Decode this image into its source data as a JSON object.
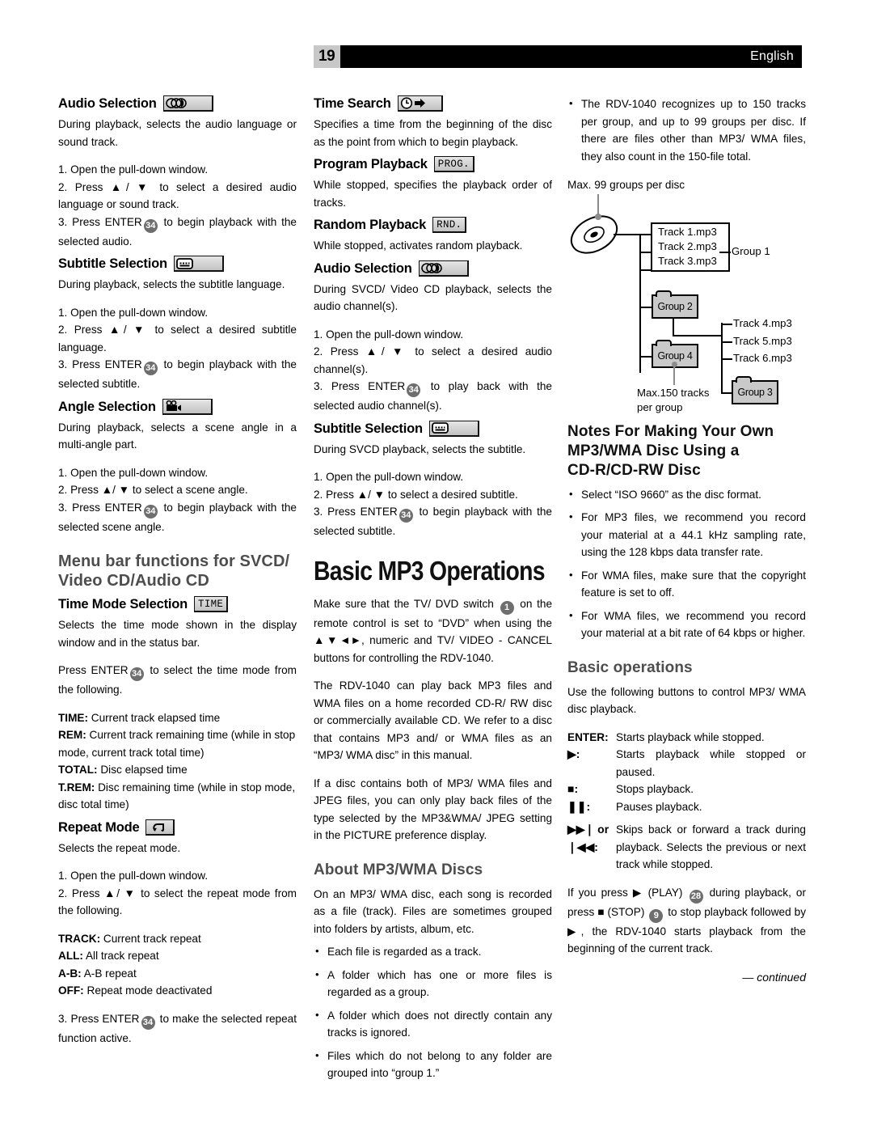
{
  "header": {
    "page_number": "19",
    "language": "English"
  },
  "col1": {
    "audio_selection": {
      "title": "Audio Selection",
      "icon": "audio-channels-icon",
      "desc": "During playback, selects the audio language or sound track.",
      "steps": [
        "1. Open the pull-down window.",
        "2. Press ▲/ ▼ to select a desired audio language or sound track.",
        "3. Press ENTER",
        "to begin playback with the selected audio."
      ],
      "key": "34"
    },
    "subtitle_selection": {
      "title": "Subtitle Selection",
      "icon": "subtitle-icon",
      "desc": "During playback, selects the subtitle language.",
      "steps": [
        "1. Open the pull-down window.",
        "2. Press ▲/ ▼ to select a desired subtitle language.",
        "3. Press ENTER",
        "to begin playback with the selected subtitle."
      ],
      "key": "34"
    },
    "angle_selection": {
      "title": "Angle Selection",
      "icon": "movie-camera-icon",
      "desc": "During playback, selects a scene angle in a multi-angle part.",
      "steps": [
        "1. Open the pull-down window.",
        "2. Press ▲/ ▼ to select a scene angle.",
        "3. Press ENTER",
        "to begin playback with the selected scene angle."
      ],
      "key": "34"
    },
    "menu_bar_heading": "Menu bar functions for SVCD/ Video CD/Audio CD",
    "time_mode": {
      "title": "Time Mode Selection",
      "badge": "TIME",
      "desc": "Selects the time mode shown in the display window and in the status bar.",
      "press_pre": "Press ENTER",
      "key": "34",
      "press_post": "to select the time mode from the following.",
      "modes": [
        {
          "name": "TIME:",
          "text": "Current track elapsed time"
        },
        {
          "name": "REM:",
          "text": "Current track remaining time (while in stop mode, current track total time)"
        },
        {
          "name": "TOTAL:",
          "text": "Disc elapsed time"
        },
        {
          "name": "T.REM:",
          "text": "Disc remaining time (while in stop mode, disc total time)"
        }
      ]
    },
    "repeat_mode": {
      "title": "Repeat Mode",
      "icon": "repeat-icon",
      "desc": "Selects the repeat mode.",
      "steps": [
        "1. Open the pull-down window.",
        "2. Press ▲/ ▼ to select the repeat mode from the following."
      ],
      "modes": [
        {
          "name": "TRACK:",
          "text": "Current track repeat"
        },
        {
          "name": "ALL:",
          "text": "All track repeat"
        },
        {
          "name": "A-B:",
          "text": "A-B repeat"
        },
        {
          "name": "OFF:",
          "text": "Repeat mode deactivated"
        }
      ],
      "final_pre": "3. Press ENTER",
      "key": "34",
      "final_post": "to make the selected repeat function active."
    }
  },
  "col2": {
    "time_search": {
      "title": "Time Search",
      "icon": "clock-arrow-icon",
      "desc": "Specifies a time from the beginning of the disc as the point from which to begin playback."
    },
    "program_playback": {
      "title": "Program Playback",
      "badge": "PROG.",
      "desc": "While stopped, specifies the playback order of tracks."
    },
    "random_playback": {
      "title": "Random Playback",
      "badge": "RND.",
      "desc": "While stopped, activates random playback."
    },
    "audio_selection": {
      "title": "Audio Selection",
      "icon": "audio-channels-icon",
      "desc": "During SVCD/ Video CD playback, selects the audio channel(s).",
      "steps": [
        "1. Open the pull-down window.",
        "2. Press ▲/ ▼ to select a desired audio channel(s).",
        "3. Press ENTER",
        "to play back with the selected audio channel(s)."
      ],
      "key": "34"
    },
    "subtitle_selection": {
      "title": "Subtitle Selection",
      "icon": "subtitle-icon",
      "desc": "During SVCD playback, selects the subtitle.",
      "steps": [
        "1. Open the pull-down window.",
        "2. Press ▲/ ▼ to select a desired subtitle.",
        "3. Press ENTER",
        "to begin playback with the selected subtitle."
      ],
      "key": "34"
    },
    "basic_mp3_title": "Basic MP3 Operations",
    "para1_a": "Make sure that the TV/ DVD switch",
    "para1_key": "1",
    "para1_b": "on the remote control is set to “DVD” when using the ▲▼◄►, numeric and TV/ VIDEO - CANCEL buttons for controlling the RDV-1040.",
    "para2": "The RDV-1040 can play back MP3 files and WMA files on a home recorded CD-R/ RW disc or commercially available CD. We refer to a disc that contains MP3 and/ or WMA files as an “MP3/ WMA disc” in this manual.",
    "para3": "If a disc contains both of MP3/ WMA files and JPEG files, you can only play back files of the type selected by the MP3&WMA/ JPEG setting in the PICTURE preference display.",
    "about_heading": "About MP3/WMA Discs",
    "about_para": "On an MP3/ WMA disc, each song is recorded as a file (track). Files are sometimes grouped into folders by artists, album, etc.",
    "about_bullets": [
      "Each file is regarded as a track.",
      "A folder which has one or more files is regarded as a group.",
      "A folder which does not directly contain any tracks is ignored.",
      "Files which do not belong to any folder are grouped into “group 1.”"
    ]
  },
  "col3": {
    "top_bullet": "The RDV-1040 recognizes up to 150 tracks per group, and up to 99 groups per disc. If there are files other than MP3/ WMA files, they also count in the 150-file total.",
    "diagram": {
      "caption_top": "Max. 99 groups per disc",
      "caption_bottom_line1": "Max.150 tracks",
      "caption_bottom_line2": "per group",
      "tracks_group1": [
        "Track 1.mp3",
        "Track 2.mp3",
        "Track 3.mp3"
      ],
      "group1_label": "Group 1",
      "group2_label": "Group 2",
      "group3_label": "Group 3",
      "group4_label": "Group 4",
      "tracks_group2": [
        "Track 4.mp3",
        "Track 5.mp3",
        "Track 6.mp3"
      ]
    },
    "notes_heading_l1": "Notes For Making Your Own",
    "notes_heading_l2": "MP3/WMA Disc Using a",
    "notes_heading_l3": "CD-R/CD-RW Disc",
    "notes_bullets": [
      "Select “ISO 9660” as the disc format.",
      "For MP3 files, we recommend you record your material at a 44.1 kHz sampling rate, using the 128 kbps data transfer rate.",
      "For WMA files, make sure that the copyright feature is set to off.",
      "For WMA files, we recommend you record your material at a bit rate of 64 kbps or higher."
    ],
    "basic_ops_heading": "Basic operations",
    "basic_ops_intro": "Use the following buttons to control MP3/ WMA disc playback.",
    "ops": [
      {
        "key": "ENTER:",
        "desc": "Starts playback while stopped.",
        "symbol": false
      },
      {
        "key": "▶:",
        "desc": "Starts playback while stopped or paused.",
        "symbol": true
      },
      {
        "key": "■:",
        "desc": "Stops playback.",
        "symbol": true
      },
      {
        "key": "❚❚:",
        "desc": "Pauses playback.",
        "symbol": true
      }
    ],
    "skip_key_line1": "▶▶❘ or",
    "skip_key_line2": "❘◀◀:",
    "skip_desc": "Skips back or forward a track during playback. Selects the previous or next track while stopped.",
    "final_a": "If you press ▶ (PLAY)",
    "final_key1": "28",
    "final_b": "during playback, or press ■ (STOP)",
    "final_key2": "9",
    "final_c": "to stop playback followed by ▶, the RDV-1040 starts playback from the beginning of the current track.",
    "continued": "— continued"
  }
}
